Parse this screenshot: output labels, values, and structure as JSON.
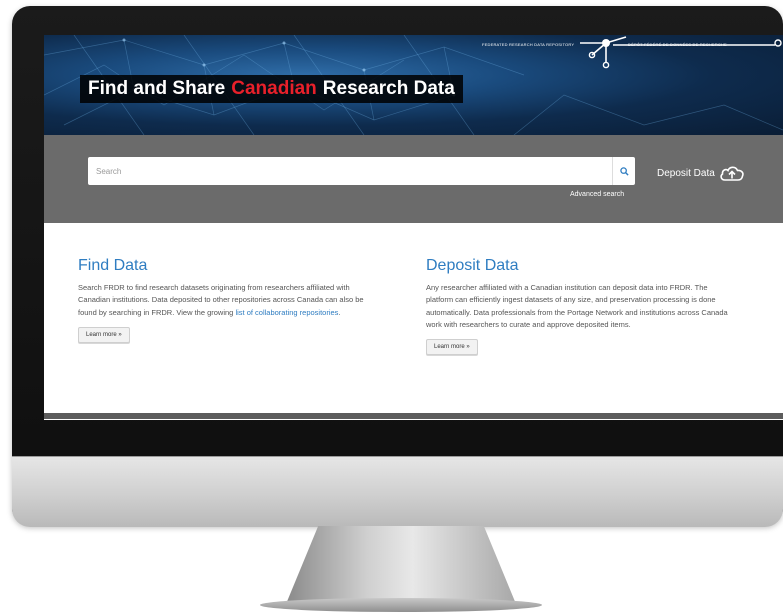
{
  "header": {
    "title_part1": "Find and Share",
    "title_accent": "Canadian",
    "title_part2": "Research Data",
    "repository_label_en": "FEDERATED RESEARCH DATA REPOSITORY",
    "repository_label_fr": "DÉPÔT FÉDÉRÉ DE DONNÉES DE RECHERCHE"
  },
  "search": {
    "placeholder": "Search",
    "advanced_label": "Advanced search"
  },
  "deposit_link": {
    "label": "Deposit Data"
  },
  "find_section": {
    "title": "Find Data",
    "body": "Search FRDR to find research datasets originating from researchers affiliated with Canadian institutions. Data deposited to other repositories across Canada can also be found by searching in FRDR. View the growing ",
    "link_label": "list of collaborating repositories",
    "body_end": ".",
    "button_label": "Learn more »"
  },
  "deposit_section": {
    "title": "Deposit Data",
    "body": "Any researcher affiliated with a Canadian institution can deposit data into FRDR. The platform can efficiently ingest datasets of any size, and preservation processing is done automatically. Data professionals from the Portage Network and institutions across Canada work with researchers to curate and approve deposited items.",
    "button_label": "Learn more »"
  },
  "colors": {
    "accent_red": "#e8202a",
    "link_blue": "#2f7dc1",
    "search_band": "#6b6b6b"
  },
  "icons": {
    "search": "search-icon",
    "deposit": "cloud-upload-icon"
  }
}
